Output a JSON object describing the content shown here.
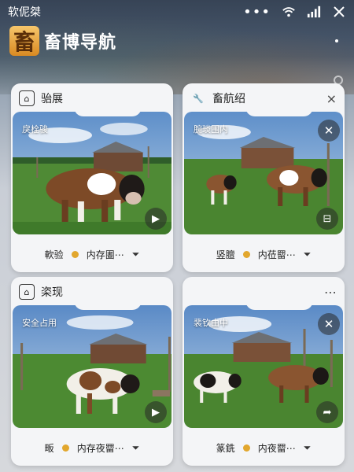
{
  "statusbar": {
    "carrier": "软伲桀"
  },
  "header": {
    "title": "畜博导航",
    "logo_char": "畜"
  },
  "colors": {
    "accent": "#e2a72e",
    "card_bg": "#f4f5f7"
  },
  "cards": [
    {
      "title": "骀展",
      "icon": "home-icon",
      "scene_label": "戾栓骏",
      "foot_left": "軟验",
      "foot_text": "内存圕⋯",
      "has_close": false,
      "corner": ""
    },
    {
      "title": "畜航绍",
      "icon": "wrench-icon",
      "scene_label": "腕琰围内",
      "foot_left": "竖膻",
      "foot_text": "内莅罶⋯",
      "has_close": true,
      "corner": "×"
    },
    {
      "title": "栥现",
      "icon": "home-icon",
      "scene_label": "安全占用",
      "foot_left": "畈",
      "foot_text": "内存夜罶⋯",
      "has_close": false,
      "corner": ""
    },
    {
      "title": "",
      "icon": "",
      "scene_label": "裴钦由中",
      "foot_left": "篆銑",
      "foot_text": "内夜罶⋯",
      "has_close": true,
      "corner": "⋯"
    }
  ]
}
